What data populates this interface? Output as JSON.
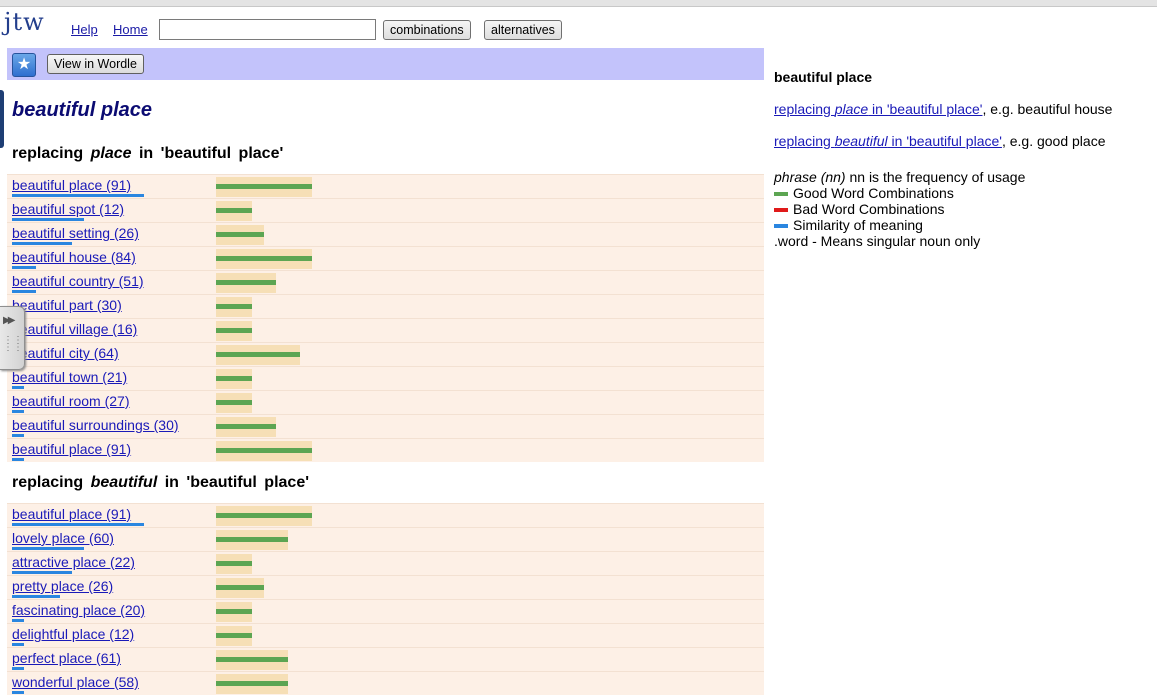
{
  "header": {
    "logo": "jtw",
    "links": [
      "Help",
      "Home"
    ],
    "search_value": "",
    "buttons": [
      "combinations",
      "alternatives"
    ]
  },
  "wordle_bar": {
    "button_label": "View in Wordle",
    "icon": "star-icon"
  },
  "main_title": "beautiful place",
  "section1": {
    "heading_prefix": "replacing",
    "heading_word": "place",
    "heading_suffix": "in  'beautiful  place'",
    "rows": [
      {
        "label": "beautiful place (91)",
        "good": 96,
        "similarity": 132
      },
      {
        "label": "beautiful spot (12)",
        "good": 36,
        "similarity": 72
      },
      {
        "label": "beautiful setting (26)",
        "good": 48,
        "similarity": 60
      },
      {
        "label": "beautiful house (84)",
        "good": 96,
        "similarity": 24
      },
      {
        "label": "beautiful country (51)",
        "good": 60,
        "similarity": 24
      },
      {
        "label": "beautiful part (30)",
        "good": 36,
        "similarity": 12
      },
      {
        "label": "beautiful village (16)",
        "good": 36,
        "similarity": 12
      },
      {
        "label": "beautiful city (64)",
        "good": 84,
        "similarity": 12
      },
      {
        "label": "beautiful town (21)",
        "good": 36,
        "similarity": 12
      },
      {
        "label": "beautiful room (27)",
        "good": 36,
        "similarity": 12
      },
      {
        "label": "beautiful surroundings (30)",
        "good": 60,
        "similarity": 12
      },
      {
        "label": "beautiful place (91)",
        "good": 96,
        "similarity": 12
      }
    ]
  },
  "section2": {
    "heading_prefix": "replacing",
    "heading_word": "beautiful",
    "heading_suffix": "in  'beautiful  place'",
    "rows": [
      {
        "label": "beautiful place (91)",
        "good": 96,
        "similarity": 132
      },
      {
        "label": "lovely place (60)",
        "good": 72,
        "similarity": 72
      },
      {
        "label": "attractive place (22)",
        "good": 36,
        "similarity": 60
      },
      {
        "label": "pretty place (26)",
        "good": 48,
        "similarity": 48
      },
      {
        "label": "fascinating place (20)",
        "good": 36,
        "similarity": 12
      },
      {
        "label": "delightful place (12)",
        "good": 36,
        "similarity": 12
      },
      {
        "label": "perfect place (61)",
        "good": 72,
        "similarity": 12
      },
      {
        "label": "wonderful place (58)",
        "good": 72,
        "similarity": 12
      }
    ]
  },
  "right_panel": {
    "title": "beautiful place",
    "link1_pre": "replacing ",
    "link1_word": "place",
    "link1_post": " in 'beautiful place'",
    "link1_eg": ", e.g.  beautiful house",
    "link2_pre": "replacing ",
    "link2_word": "beautiful",
    "link2_post": " in 'beautiful place'",
    "link2_eg": ", e.g.  good place",
    "legend_phrase": "phrase (nn)",
    "legend_phrase_desc": " nn is the frequency of usage",
    "legend_good": "Good Word Combinations",
    "legend_bad": "Bad Word Combinations",
    "legend_sim": "Similarity of meaning",
    "legend_word": ".word - Means singular noun only",
    "colors": {
      "good": "#5ca552",
      "bad": "#e01a1a",
      "similarity": "#2a86e0"
    }
  }
}
